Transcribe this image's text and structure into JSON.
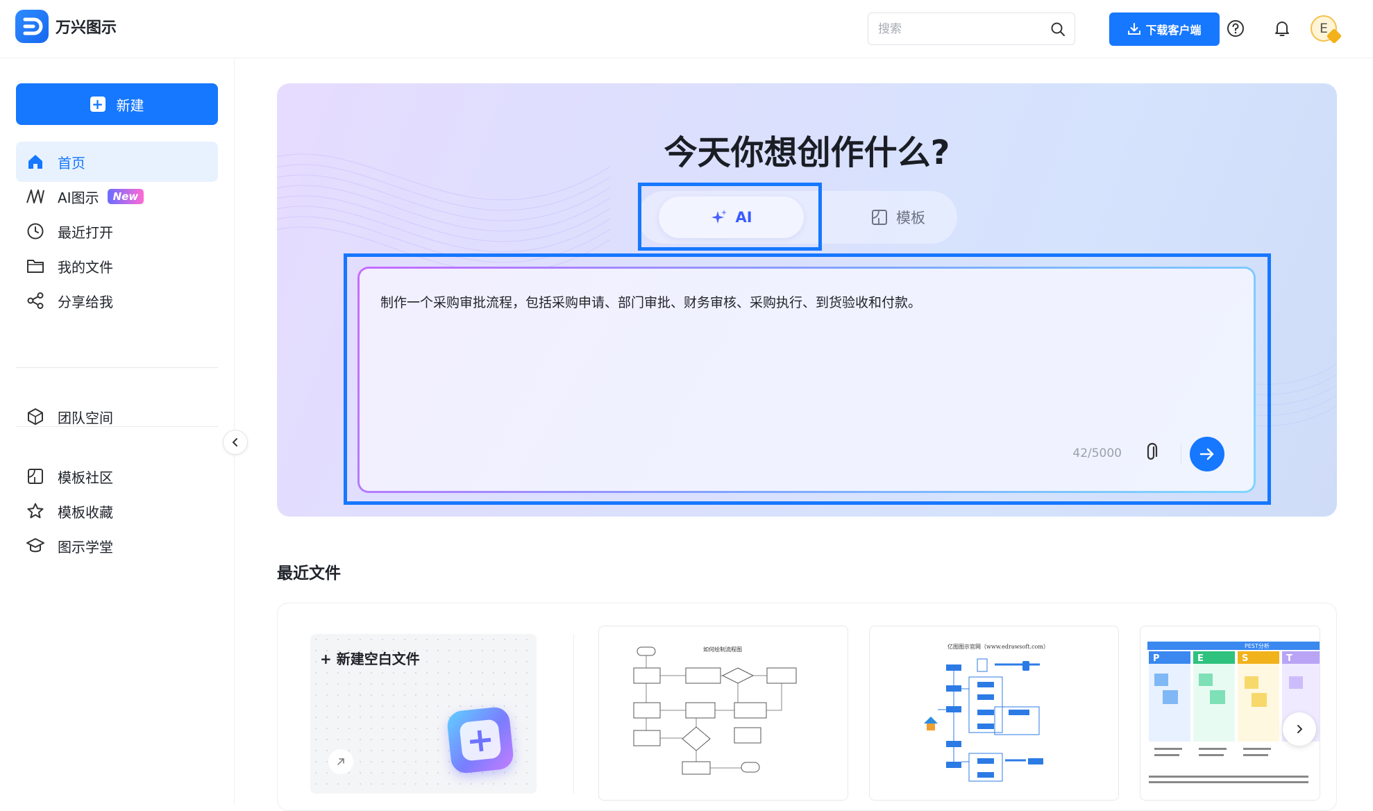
{
  "app": {
    "name": "万兴图示"
  },
  "header": {
    "search_placeholder": "搜索",
    "download_label": "下载客户端",
    "avatar_letter": "E"
  },
  "sidebar": {
    "new_label": "新建",
    "items": [
      {
        "label": "首页",
        "icon": "home-icon",
        "active": true
      },
      {
        "label": "AI图示",
        "icon": "ai-diagram-icon",
        "badge": "New"
      },
      {
        "label": "最近打开",
        "icon": "clock-icon"
      },
      {
        "label": "我的文件",
        "icon": "folder-icon"
      },
      {
        "label": "分享给我",
        "icon": "share-icon"
      },
      {
        "label": "团队空间",
        "icon": "cube-icon"
      },
      {
        "label": "模板社区",
        "icon": "template-icon"
      },
      {
        "label": "模板收藏",
        "icon": "star-icon"
      },
      {
        "label": "图示学堂",
        "icon": "graduation-cap-icon"
      }
    ]
  },
  "hero": {
    "title": "今天你想创作什么?",
    "tabs": [
      {
        "label": "AI",
        "active": true
      },
      {
        "label": "模板",
        "active": false
      }
    ],
    "prompt_text": "制作一个采购审批流程，包括采购申请、部门审批、财务审核、采购执行、到货验收和付款。",
    "char_count": "42/5000"
  },
  "recent": {
    "title": "最近文件",
    "new_blank_label": "+ 新建空白文件",
    "thumbnails": [
      {
        "caption": "如何绘制流程图"
      },
      {
        "caption": "亿图图示官网（www.edrawsoft.com）"
      },
      {
        "caption": "PEST分析",
        "letters": [
          "P",
          "E",
          "S",
          "T"
        ]
      }
    ]
  },
  "colors": {
    "accent": "#1677ff",
    "highlight": "#1677ff"
  }
}
